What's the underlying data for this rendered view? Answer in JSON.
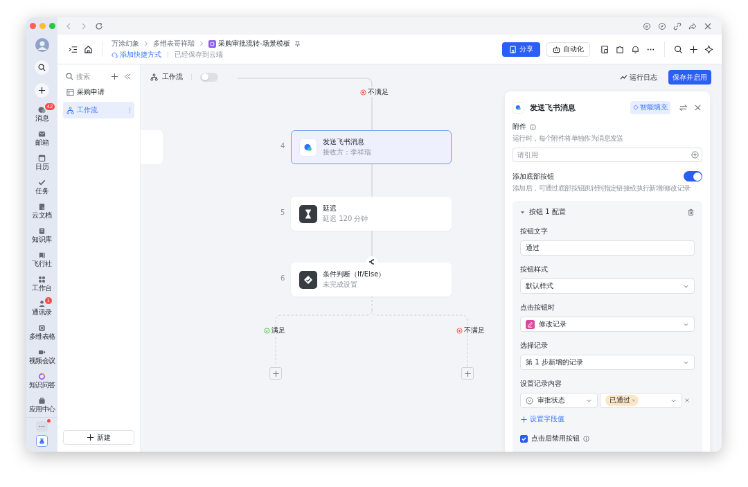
{
  "rail": {
    "items": [
      {
        "label": "消息",
        "kind": "chat",
        "badge": "42"
      },
      {
        "label": "邮箱",
        "kind": "mail"
      },
      {
        "label": "日历",
        "kind": "calendar"
      },
      {
        "label": "任务",
        "kind": "task"
      },
      {
        "label": "云文档",
        "kind": "doc"
      },
      {
        "label": "知识库",
        "kind": "book"
      },
      {
        "label": "飞行社",
        "kind": "flag"
      },
      {
        "label": "工作台",
        "kind": "grid"
      },
      {
        "label": "通讯录",
        "kind": "contacts",
        "badge": "1"
      },
      {
        "label": "多维表格",
        "kind": "table"
      },
      {
        "label": "视频会议",
        "kind": "video"
      },
      {
        "label": "知识问答",
        "kind": "ring"
      },
      {
        "label": "应用中心",
        "kind": "bag"
      }
    ],
    "more_notification": true
  },
  "header": {
    "breadcrumbs": [
      "万涂幻象",
      "多维表哥祥瑞",
      "采购审批流转-场景模板"
    ],
    "shortcut_link": "添加快捷方式",
    "save_status": "已经保存到云端",
    "share_button": "分享",
    "automation_button": "自动化"
  },
  "sidebar": {
    "search_placeholder": "搜索",
    "items": [
      {
        "label": "采购申请",
        "kind": "table",
        "selected": false
      },
      {
        "label": "工作流",
        "kind": "workflow",
        "selected": true
      }
    ],
    "new_button": "新建"
  },
  "canvas": {
    "title": "工作流",
    "enabled": false,
    "run_log": "运行日志",
    "save_button": "保存并启用",
    "top_branch_label": "不满足",
    "nodes": [
      {
        "step": "4",
        "title": "发送飞书消息",
        "subtitle": "接收方：李祥瑞",
        "kind": "message",
        "selected": true
      },
      {
        "step": "5",
        "title": "延迟",
        "subtitle": "延迟 120 分钟",
        "kind": "delay",
        "selected": false
      },
      {
        "step": "6",
        "title": "条件判断（If/Else）",
        "subtitle": "未完成设置",
        "kind": "condition",
        "selected": false
      }
    ],
    "branches": [
      {
        "label": "满足",
        "kind": "yes"
      },
      {
        "label": "不满足",
        "kind": "no"
      }
    ]
  },
  "panel": {
    "title": "发送飞书消息",
    "smart_fill": "智能填充",
    "attachment": {
      "label": "附件",
      "hint": "运行时，每个附件将单独作为消息发送",
      "placeholder": "请引用"
    },
    "bottom_button": {
      "label": "添加底部按钮",
      "on": true,
      "hint": "添加后，可通过底部按钮跳转到指定链接或执行新增/修改记录"
    },
    "config": {
      "title": "按钮 1 配置",
      "expanded": true,
      "fields": [
        {
          "label": "按钮文字",
          "kind": "text",
          "value": "通过"
        },
        {
          "label": "按钮样式",
          "kind": "select",
          "value": "默认样式"
        },
        {
          "label": "点击按钮时",
          "kind": "select_icon",
          "value": "修改记录"
        },
        {
          "label": "选择记录",
          "kind": "select",
          "value": "第 1 步新增的记录"
        }
      ],
      "record_content": {
        "label": "设置记录内容",
        "field": "审批状态",
        "tag": "已通过"
      },
      "add_field": "设置字段值",
      "disable_after_click": {
        "label": "点击后禁用按钮",
        "checked": true
      }
    }
  }
}
